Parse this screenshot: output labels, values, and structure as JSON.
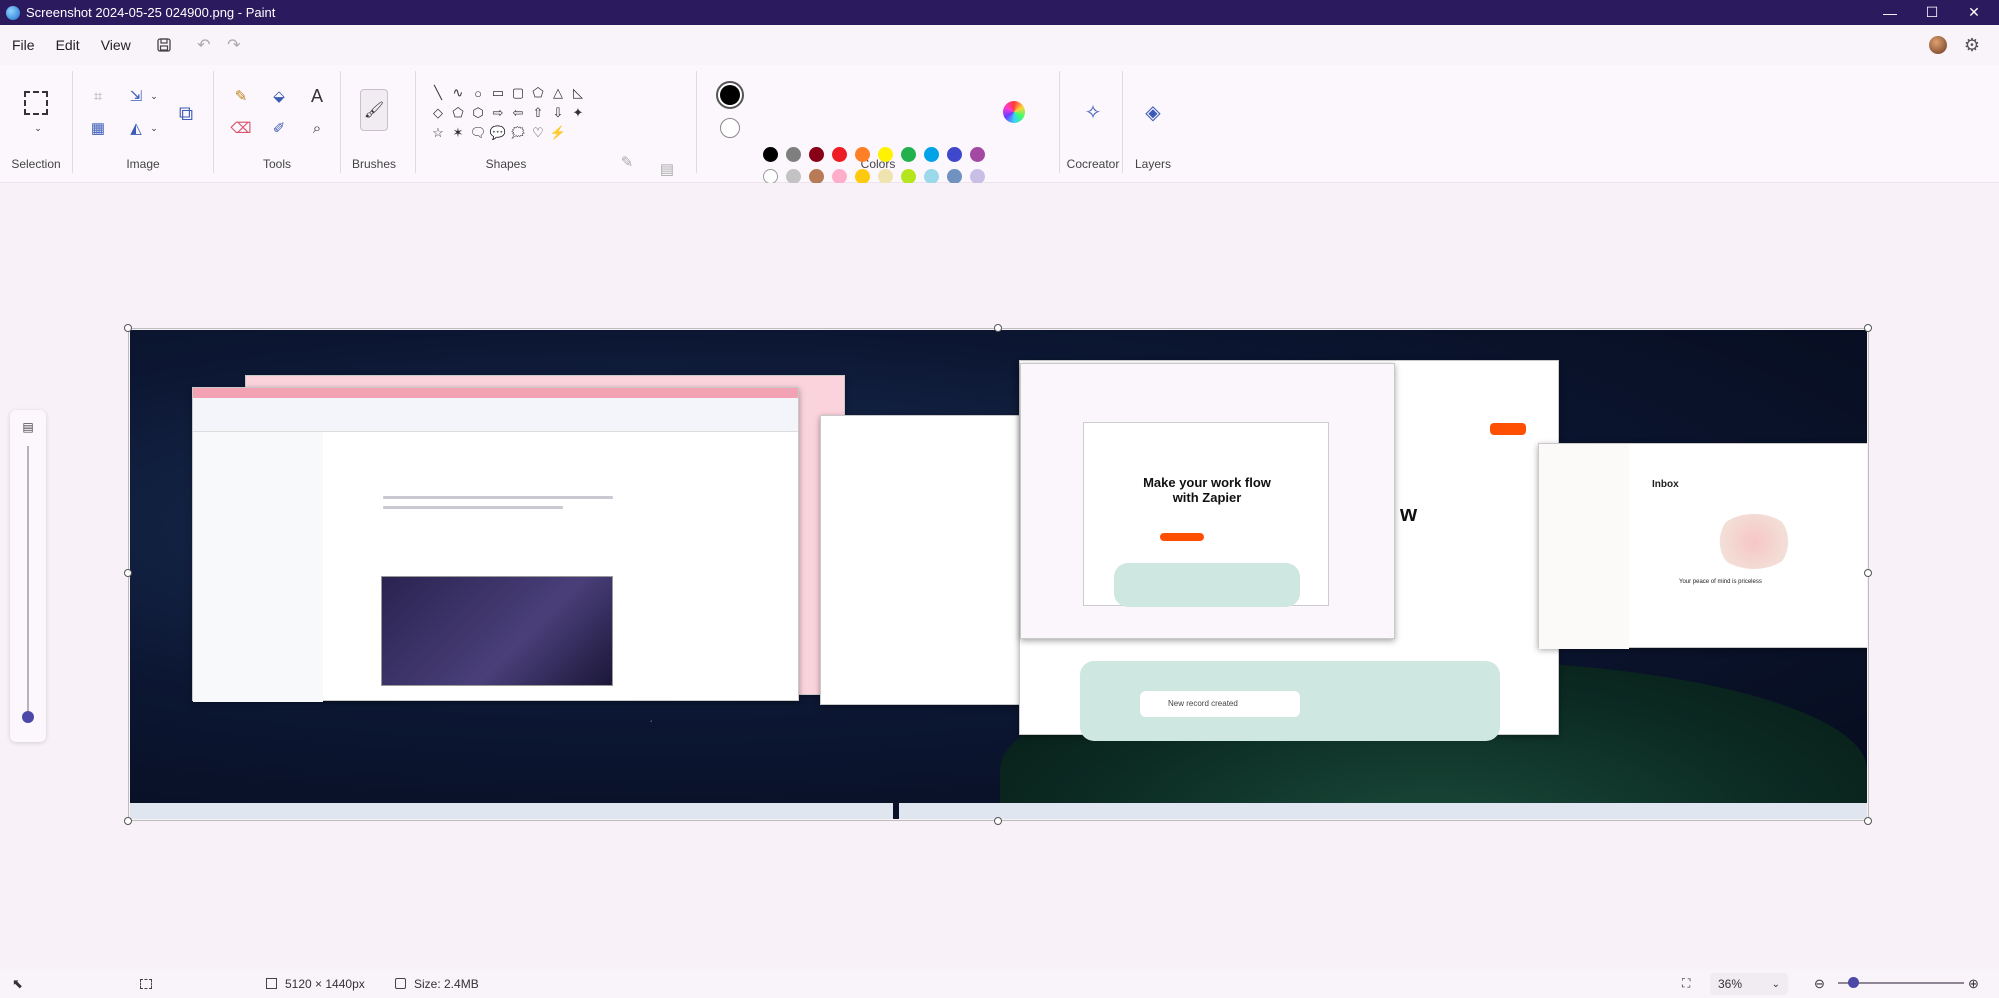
{
  "window": {
    "title": "Screenshot 2024-05-25 024900.png - Paint",
    "controls": {
      "minimize": "—",
      "maximize": "☐",
      "close": "✕"
    }
  },
  "menu": {
    "items": [
      "File",
      "Edit",
      "View"
    ],
    "icons": [
      "save-icon",
      "undo-icon",
      "redo-icon"
    ]
  },
  "ribbon": {
    "groups": {
      "selection": "Selection",
      "image": "Image",
      "tools": "Tools",
      "brushes": "Brushes",
      "shapes": "Shapes",
      "colors": "Colors",
      "cocreator": "Cocreator",
      "layers": "Layers"
    },
    "shapes": [
      "╲",
      "∿",
      "○",
      "▭",
      "▢",
      "⬠",
      "△",
      "◺",
      "◇",
      "⬠",
      "⬡",
      "⇨",
      "⇦",
      "⇧",
      "⇩",
      "✦",
      "☆",
      "✶",
      "🗨",
      "💬",
      "🗯",
      "♡",
      "⚡"
    ],
    "colors": {
      "primary": "#000000",
      "secondary": "#ffffff",
      "row1": [
        "#000000",
        "#7f7f7f",
        "#880015",
        "#ed1c24",
        "#ff7f27",
        "#fff200",
        "#22b14c",
        "#00a2e8",
        "#3f48cc",
        "#a349a4"
      ],
      "row2": [
        "#ffffff",
        "#c3c3c3",
        "#b97a57",
        "#ffaec9",
        "#ffc90e",
        "#efe4b0",
        "#b5e61d",
        "#99d9ea",
        "#7092be",
        "#c8bfe7"
      ]
    }
  },
  "canvas_image": {
    "zapier_headline": "Make your work flow with Zapier",
    "zapier_sub_headline": "w",
    "inbox_title": "Inbox",
    "todoist_message": "Your peace of mind is priceless",
    "record_created": "New record created"
  },
  "status": {
    "dimensions": "5120 × 1440px",
    "size": "Size: 2.4MB",
    "zoom": "36%"
  }
}
